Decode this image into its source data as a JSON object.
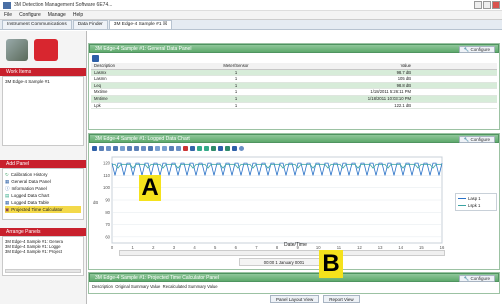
{
  "window": {
    "title": "3M Detection Management Software 6E74..."
  },
  "menu": [
    "File",
    "Configure",
    "Manage",
    "Help"
  ],
  "tabs": [
    {
      "label": "Instrument Communications",
      "active": false
    },
    {
      "label": "Data Finder",
      "active": false
    },
    {
      "label": "3M Edge-4 Sample #1 ☒",
      "active": true
    }
  ],
  "left": {
    "work_items_title": "Work Items",
    "work_items": [
      "3M Edge-4 Sample #1"
    ],
    "add_panel_title": "Add Panel",
    "add_panel_items": [
      "Calibration History",
      "General Data Panel",
      "Information Panel",
      "Logged Data Chart",
      "Logged Data Table",
      "Projected Time Calculator"
    ],
    "arrange_title": "Arrange Panels",
    "arrange_items": [
      "3M Edge-4 Sample #1: Genera",
      "3M Edge-4 Sample #1: Logge",
      "3M Edge-4 Sample #1: Project"
    ]
  },
  "general_panel": {
    "title": "3M Edge-4 Sample #1: General Data Panel",
    "configure_label": "Configure",
    "columns": [
      "Description",
      "Meter/Sensor",
      "Value"
    ],
    "rows": [
      [
        "Lasmx",
        "1",
        "98.7 dB"
      ],
      [
        "Lasmn",
        "1",
        "105 dB"
      ],
      [
        "Leq",
        "1",
        "98.8 dB"
      ],
      [
        "Mxtime",
        "1",
        "1/18/2011 5:26:11 PM"
      ],
      [
        "Mntime",
        "1",
        "1/18/2011 10:03:10 PM"
      ],
      [
        "Lpk",
        "1",
        "122.1 dB"
      ]
    ]
  },
  "chart_panel": {
    "title": "3M Edge-4 Sample #1: Logged Data Chart",
    "configure_label": "Configure",
    "x_title": "Date/Time",
    "x_date": "00:00 1 January 0001",
    "legend": [
      "Lasp 1",
      "Lspk 1"
    ],
    "legend_colors": [
      "#2a72c8",
      "#3aa3a3"
    ],
    "marker_a": "A",
    "marker_b": "B",
    "y_label": "dB"
  },
  "chart_data": {
    "type": "line",
    "xlabel": "Date/Time",
    "ylabel": "dB",
    "yticks": [
      120,
      110,
      100,
      90,
      80,
      70,
      60
    ],
    "ylim": [
      55,
      125
    ],
    "xticks": [
      "0",
      "1",
      "2",
      "3",
      "4",
      "5",
      "6",
      "7",
      "8",
      "9",
      "10",
      "11",
      "12",
      "13",
      "14",
      "15",
      "16"
    ],
    "series": [
      {
        "name": "Lasp 1",
        "color": "#2a72c8",
        "baseline": 120,
        "dip": 110
      },
      {
        "name": "Lspk 1",
        "color": "#3aa3a3",
        "baseline": 119,
        "dip": 116
      }
    ],
    "grid": true,
    "legend_position": "right"
  },
  "projected_panel": {
    "title": "3M Edge-4 Sample #1: Projected Time Calculator Panel",
    "configure_label": "Configure",
    "columns_text": "Description  Original Summary Value  Recalculated Summary Value"
  },
  "bottom": {
    "panel_layout": "Panel Layout View",
    "report": "Report View"
  }
}
